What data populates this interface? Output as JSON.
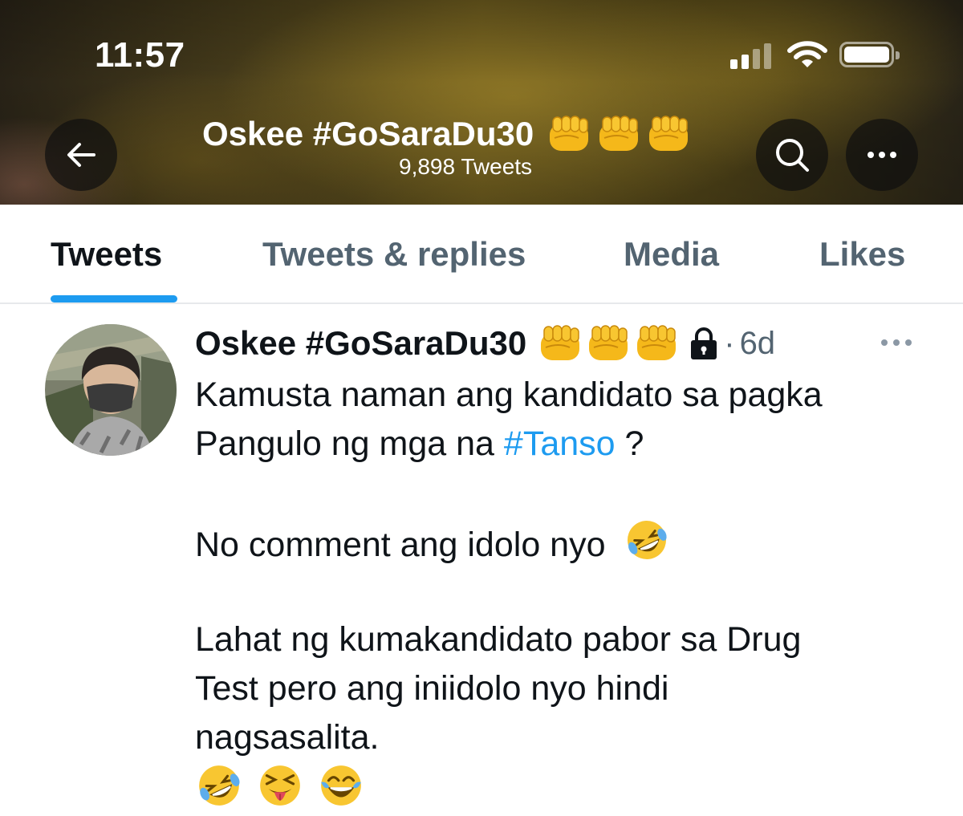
{
  "status_bar": {
    "time": "11:57"
  },
  "header": {
    "title": "Oskee #GoSaraDu30",
    "tweet_count": "9,898 Tweets"
  },
  "tabs": [
    {
      "label": "Tweets",
      "active": true
    },
    {
      "label": "Tweets & replies",
      "active": false
    },
    {
      "label": "Media",
      "active": false
    },
    {
      "label": "Likes",
      "active": false
    }
  ],
  "tweet": {
    "author": "Oskee #GoSaraDu30",
    "separator": "·",
    "time": "6d",
    "text": {
      "line1": "Kamusta naman ang kandidato sa pagka",
      "line2_before": "Pangulo ng mga na ",
      "line2_hashtag": "#Tanso",
      "line2_after": " ?",
      "line3": "No comment ang idolo nyo",
      "line4": "Lahat ng kumakandidato pabor sa Drug",
      "line5": "Test pero ang iniidolo nyo hindi",
      "line6": "nagsasalita."
    }
  },
  "colors": {
    "accent": "#1d9bf0",
    "text_primary": "#0f1419",
    "text_secondary": "#536471"
  },
  "icons": [
    "back-arrow-icon",
    "search-icon",
    "more-icon",
    "lock-icon",
    "fist-emoji",
    "rofl-emoji",
    "squinting-tongue-emoji",
    "tears-of-joy-emoji"
  ]
}
